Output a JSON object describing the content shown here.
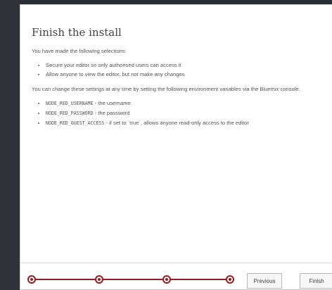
{
  "dialog": {
    "title": "Finish the install",
    "intro": "You have made the following selections:",
    "selections": [
      "Secure your editor so only authorised users can access it",
      "Allow anyone to view the editor, but not make any changes"
    ],
    "change_note": "You can change these settings at any time by setting the following environment variables via the Bluemix console:",
    "env_vars": [
      {
        "name": "NODE_RED_USERNAME",
        "desc": " - the username"
      },
      {
        "name": "NODE_RED_PASSWORD",
        "desc": " - the password"
      },
      {
        "name": "NODE_RED_GUEST_ACCESS",
        "desc": " - if set to `true`, allows anyone read-only access to the editor"
      }
    ]
  },
  "footer": {
    "steps": {
      "total": 4,
      "current": 4
    },
    "previous_label": "Previous",
    "finish_label": "Finish"
  },
  "colors": {
    "accent": "#9b1c1c",
    "background": "#2b2f34"
  }
}
